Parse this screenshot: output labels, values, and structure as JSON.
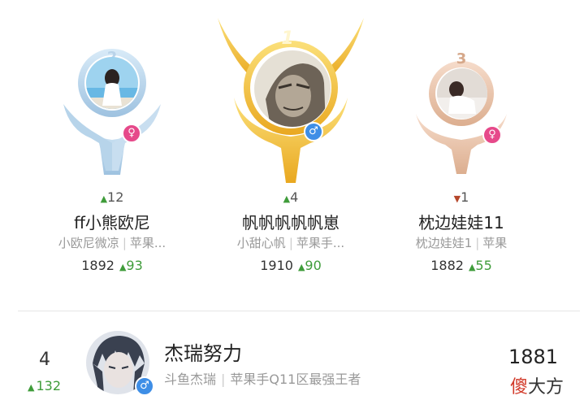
{
  "top3": [
    {
      "slot": "p2",
      "rank": "2",
      "change_dir": "up",
      "change": "12",
      "name": "ff小熊欧尼",
      "alias": "小欧尼微凉",
      "server": "苹果...",
      "score": "1892",
      "score_delta": "93",
      "gender": "female",
      "gender_glyph": "♀"
    },
    {
      "slot": "p1",
      "rank": "1",
      "change_dir": "up",
      "change": "4",
      "name": "帆帆帆帆帆崽",
      "alias": "小甜心帆",
      "server": "苹果手...",
      "score": "1910",
      "score_delta": "90",
      "gender": "male",
      "gender_glyph": "♂"
    },
    {
      "slot": "p3",
      "rank": "3",
      "change_dir": "down",
      "change": "1",
      "name": "枕边娃娃11",
      "alias": "枕边娃娃1",
      "server": "苹果",
      "score": "1882",
      "score_delta": "55",
      "gender": "female",
      "gender_glyph": "♀"
    }
  ],
  "row4": {
    "rank": "4",
    "change": "132",
    "name": "杰瑞努力",
    "alias": "斗鱼杰瑞",
    "server": "苹果手Q11区最强王者",
    "score": "1881",
    "gender_glyph": "♂"
  },
  "watermark": {
    "red": "傻",
    "black": "大方"
  },
  "colors": {
    "gold": "#f2c23c",
    "silver": "#a9cbe6",
    "bronze": "#e9c1a6",
    "up": "#3f9c3a",
    "down": "#b5472b",
    "female": "#e6498a",
    "male": "#3e8ee6"
  }
}
